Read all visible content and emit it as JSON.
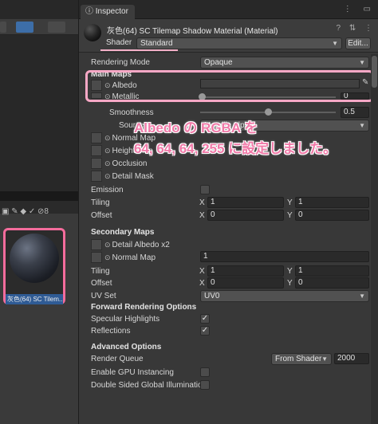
{
  "inspector": {
    "tab_label": "Inspector",
    "tab_icons": "⋮ ▭",
    "material_title": "灰色(64) SC Tilemap Shadow Material (Material)",
    "header_icons": "? ⇅ ⋮",
    "shader_label": "Shader",
    "shader_value": "Standard",
    "edit_button": "Edit...",
    "rendering_mode_label": "Rendering Mode",
    "rendering_mode_value": "Opaque",
    "main_maps_header": "Main Maps",
    "albedo_label": "Albedo",
    "metallic_label": "Metallic",
    "metallic_value": "0",
    "smoothness_label": "Smoothness",
    "smoothness_value": "0.5",
    "smoothness_fraction": 0.5,
    "source_label": "Source",
    "source_value": "Metallic Alpha",
    "normal_map_label": "Normal Map",
    "height_map_label": "Height Map",
    "occlusion_label": "Occlusion",
    "detail_mask_label": "Detail Mask",
    "emission_label": "Emission",
    "tiling_label": "Tiling",
    "offset_label": "Offset",
    "main_tiling": {
      "x": "1",
      "y": "1"
    },
    "main_offset": {
      "x": "0",
      "y": "0"
    },
    "axis_x": "X",
    "axis_y": "Y",
    "secondary_maps_header": "Secondary Maps",
    "detail_albedo_label": "Detail Albedo x2",
    "secondary_normal_label": "Normal Map",
    "secondary_normal_value": "1",
    "secondary_tiling": {
      "x": "1",
      "y": "1"
    },
    "secondary_offset": {
      "x": "0",
      "y": "0"
    },
    "uv_set_label": "UV Set",
    "uv_set_value": "UV0",
    "forward_header": "Forward Rendering Options",
    "specular_label": "Specular Highlights",
    "reflections_label": "Reflections",
    "advanced_header": "Advanced Options",
    "render_queue_label": "Render Queue",
    "render_queue_mode": "From Shader",
    "render_queue_value": "2000",
    "gpu_instancing_label": "Enable GPU Instancing",
    "double_sided_label": "Double Sided Global Illumination",
    "checkmark": "✓"
  },
  "project": {
    "icons": "▣ ✎ ◆ ✓ ⊘8",
    "selected_asset_name": "灰色(64) SC Tilem..."
  },
  "annotation": {
    "line1": "Albedo の RGBA を",
    "line2": "64, 64, 64, 255 に設定しました。"
  },
  "colors": {
    "highlight": "#f8a8c6",
    "annotation_text": "#f07aa8",
    "selection_blue": "#2f5b95"
  }
}
